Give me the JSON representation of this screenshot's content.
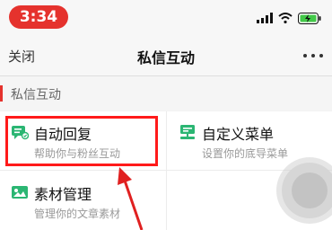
{
  "status_bar": {
    "time": "3:34",
    "icons": [
      "signal-icon",
      "wifi-icon",
      "battery-charging-icon"
    ]
  },
  "navbar": {
    "close_label": "关闭",
    "title": "私信互动",
    "more_icon": "more-dots-icon"
  },
  "section": {
    "label": "私信互动"
  },
  "grid": {
    "items": [
      {
        "title": "自动回复",
        "subtitle": "帮助你与粉丝互动",
        "icon": "auto-reply-icon"
      },
      {
        "title": "自定义菜单",
        "subtitle": "设置你的底导菜单",
        "icon": "custom-menu-icon"
      },
      {
        "title": "素材管理",
        "subtitle": "管理你的文章素材",
        "icon": "material-icon"
      }
    ]
  },
  "colors": {
    "accent": "#e5322d",
    "icon_green": "#2bb673",
    "highlight_red": "#ff1a1a"
  }
}
